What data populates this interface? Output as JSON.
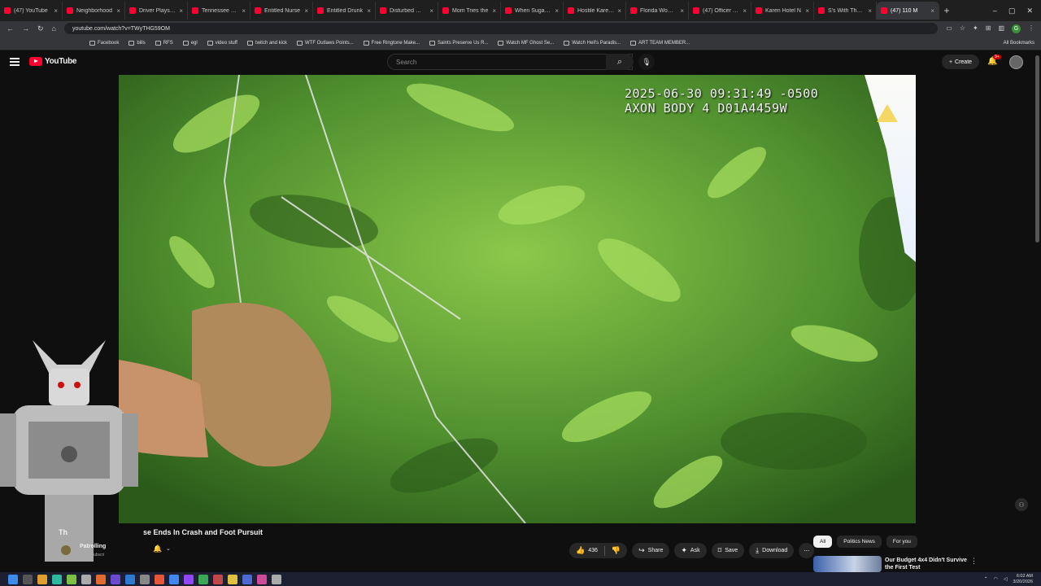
{
  "browser": {
    "tabs": [
      {
        "title": "(47) YouTube"
      },
      {
        "title": "Neighborhood"
      },
      {
        "title": "Driver Plays the"
      },
      {
        "title": "Tennessee Sen"
      },
      {
        "title": "Entitled Nurse"
      },
      {
        "title": "Entitled Drunk"
      },
      {
        "title": "Disturbed Wom"
      },
      {
        "title": "Mom Tries the"
      },
      {
        "title": "When Sugar D"
      },
      {
        "title": "Hostile Karen T"
      },
      {
        "title": "Florida Woman"
      },
      {
        "title": "(47) Officer Du"
      },
      {
        "title": "Karen Hotel N"
      },
      {
        "title": "S's With The V"
      },
      {
        "title": "(47) 110 M"
      }
    ],
    "url": "youtube.com/watch?v=TWyTHG59OM",
    "bookmarks": [
      "Facebook",
      "bills",
      "RFS",
      "egl",
      "video stuff",
      "twitch and kick",
      "WTF Outlaws Points...",
      "Free Ringtone Make...",
      "Saints Preserve Us R...",
      "Watch MF Ghost Se...",
      "Watch Hell's Paradis...",
      "ART TEAM MEMBER..."
    ],
    "all_bookmarks": "All Bookmarks"
  },
  "youtube": {
    "logo_text": "YouTube",
    "search_placeholder": "Search",
    "create_label": "Create",
    "notif_count": "9+"
  },
  "video": {
    "overlay_line1": "2025-06-30 09:31:49 -0500",
    "overlay_line2": "AXON BODY 4 D01A4459W",
    "title_prefix": "Th",
    "title": "se Ends In Crash and Foot Pursuit",
    "channel": "Patrolling",
    "subscribers": "99.2K subscri",
    "likes": "436",
    "share": "Share",
    "ask": "Ask",
    "save": "Save",
    "download": "Download"
  },
  "recommend": {
    "chips": [
      "All",
      "Politics News",
      "For you"
    ],
    "first_title": "Our Budget 4x4 Didn't Survive the First Test"
  },
  "taskbar": {
    "time": "6:02 AM",
    "date": "3/20/2026"
  },
  "colors": {
    "accent": "#ff0033",
    "background": "#0f0f0f"
  }
}
